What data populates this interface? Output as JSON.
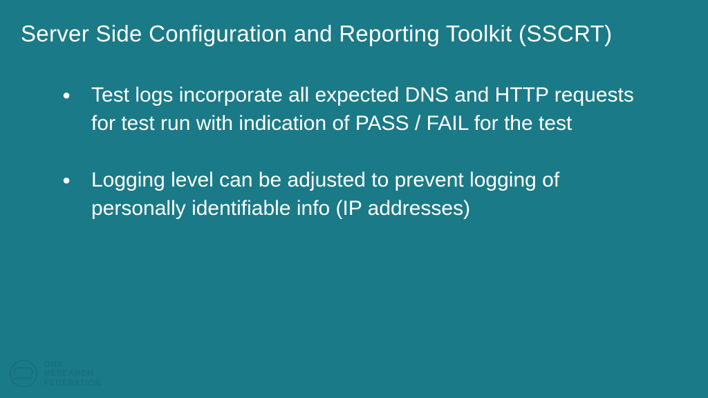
{
  "title": "Server Side Configuration and Reporting Toolkit (SSCRT)",
  "bullets": [
    "Test logs incorporate all expected DNS and HTTP requests for test run with indication of PASS / FAIL for the test",
    "Logging level can be adjusted to prevent logging of personally identifiable info (IP addresses)"
  ],
  "logo": {
    "line1": "DNS",
    "line2": "RESEARCH",
    "line3": "FEDERATION"
  }
}
